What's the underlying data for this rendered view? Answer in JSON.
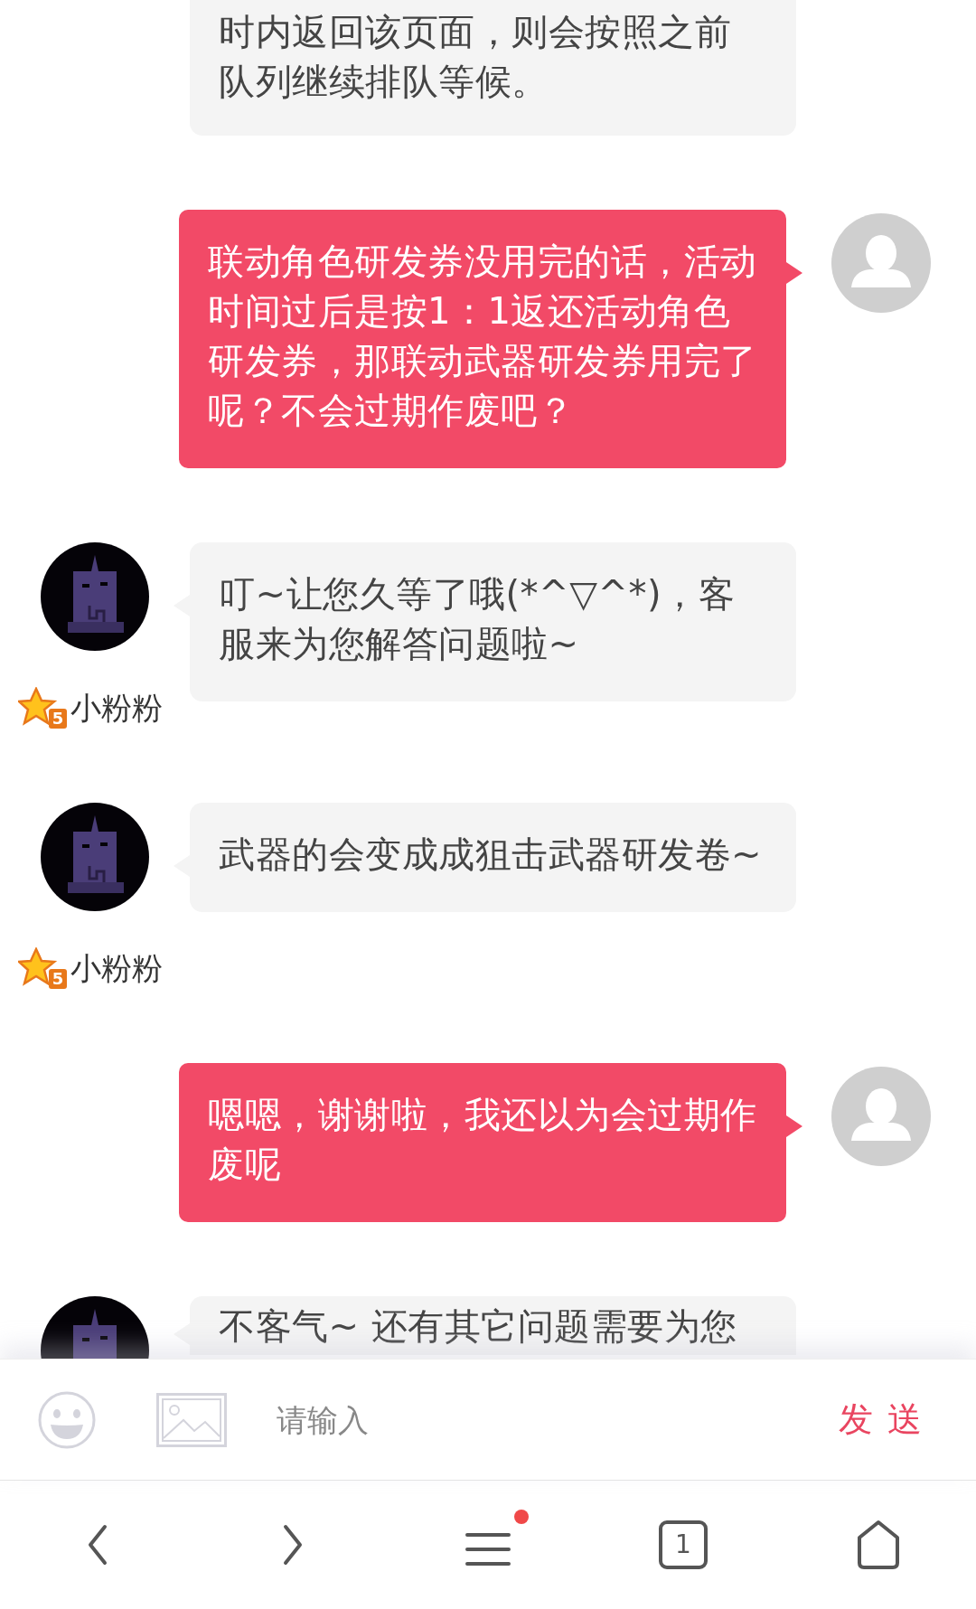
{
  "messages": [
    {
      "kind": "agent",
      "text": "时内返回该页面，则会按照之前队列继续排队等候。"
    },
    {
      "kind": "user",
      "text": "联动角色研发券没用完的话，活动时间过后是按1：1返还活动角色研发券，那联动武器研发券用完了呢？不会过期作废吧？"
    },
    {
      "kind": "agent",
      "text": "叮~让您久等了哦(*^▽^*)，客服来为您解答问题啦~",
      "name": "小粉粉",
      "badge": "5"
    },
    {
      "kind": "agent",
      "text": "武器的会变成成狙击武器研发卷~",
      "name": "小粉粉",
      "badge": "5"
    },
    {
      "kind": "user",
      "text": "嗯嗯，谢谢啦，我还以为会过期作废呢"
    },
    {
      "kind": "agent",
      "text": "不客气~ 还有其它问题需要为您"
    }
  ],
  "composer": {
    "placeholder": "请输入",
    "send": "发 送"
  },
  "nav": [
    {
      "kind": "back"
    },
    {
      "kind": "forward"
    },
    {
      "kind": "menu",
      "notification": true
    },
    {
      "kind": "tabs",
      "count": "1"
    },
    {
      "kind": "home"
    }
  ]
}
